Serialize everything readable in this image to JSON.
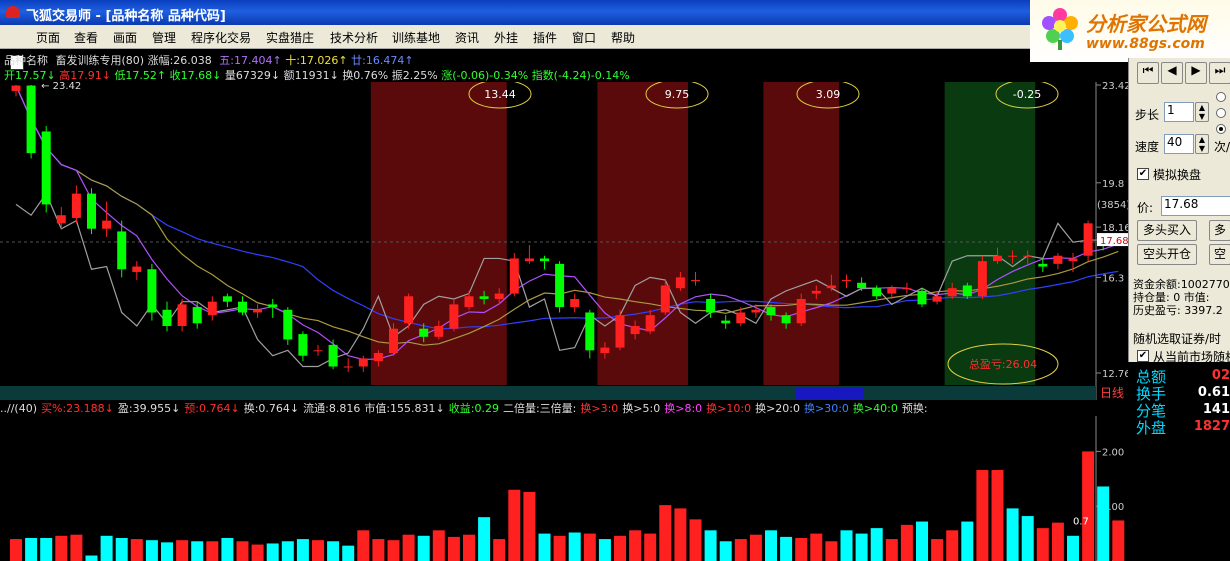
{
  "window": {
    "title": "飞狐交易师 - [品种名称 品种代码]"
  },
  "menu": [
    "页面",
    "查看",
    "画面",
    "管理",
    "程序化交易",
    "实盘猎庄",
    "技术分析",
    "训练基地",
    "资讯",
    "外挂",
    "插件",
    "窗口",
    "帮助"
  ],
  "logo": {
    "name": "分析家公式网",
    "url": "www.88gs.com"
  },
  "info_line1": {
    "name": "品种名称",
    "training": "畜发训练专用(80)",
    "amplitude": "涨幅:26.038",
    "ma5": "五:17.404↑",
    "ma10": "十:17.026↑",
    "ma20": "廿:16.474↑"
  },
  "info_line2": {
    "open": "开17.57↓",
    "high": "高17.91↓",
    "low": "低17.52↑",
    "close": "收17.68↓",
    "volume": "量67329↓",
    "amount": "额11931↓",
    "turnover": "换0.76%",
    "swing": "振2.25%",
    "change": "涨(-0.06)-0.34%",
    "index": "指数(-4.24)-0.14%"
  },
  "ellipses": [
    "13.44",
    "9.75",
    "3.09",
    "-0.25"
  ],
  "total_profit": "总盈亏:26.04",
  "high_marker": "23.42",
  "price_axis": [
    "23.42",
    "19.8",
    "18.16",
    "16.3",
    "12.76"
  ],
  "axis_badge": "(3854)",
  "current_price_tag": "17.68",
  "day_label": "日线",
  "indicator_bar": [
    {
      "t": "..//(40)",
      "c": "#ddd"
    },
    {
      "t": "买%:23.188↓",
      "c": "#ff3030"
    },
    {
      "t": "盈:39.955↓",
      "c": "#ddd"
    },
    {
      "t": "预:0.764↓",
      "c": "#ff3030"
    },
    {
      "t": "换:0.764↓",
      "c": "#ddd"
    },
    {
      "t": "流通:8.816",
      "c": "#ddd"
    },
    {
      "t": "市值:155.831↓",
      "c": "#ddd"
    },
    {
      "t": "收益:0.29",
      "c": "#30ff30"
    },
    {
      "t": "二倍量:三倍量:",
      "c": "#ddd"
    },
    {
      "t": "换>3:0",
      "c": "#ff3030"
    },
    {
      "t": "换>5:0",
      "c": "#ddd"
    },
    {
      "t": "换>8:0",
      "c": "#ff40ff"
    },
    {
      "t": "换>10:0",
      "c": "#ff3030"
    },
    {
      "t": "换>20:0",
      "c": "#ddd"
    },
    {
      "t": "换>30:0",
      "c": "#4080ff"
    },
    {
      "t": "换>40:0",
      "c": "#30ff30"
    },
    {
      "t": "预换:",
      "c": "#ddd"
    }
  ],
  "vol_axis": [
    "2.00",
    "1.00",
    "0.00"
  ],
  "vol_last_label": "0.7",
  "panel": {
    "step_label": "步长",
    "step_value": "1",
    "speed_label": "速度",
    "speed_value": "40",
    "times_label": "次/",
    "sim_label": "模拟换盘",
    "price_label": "价:",
    "price_value": "17.68",
    "btn_long_buy": "多头买入",
    "btn_long_more": "多",
    "btn_short_open": "空头开仓",
    "btn_short_more": "空",
    "fund_line": "资金余额:1002770",
    "position_line": "持仓量: 0   市值:",
    "history_line": "历史盈亏: 3397.2",
    "random_pick": "随机选取证券/时",
    "from_market": "从当前市场随机"
  },
  "data_panel": [
    {
      "label": "总额",
      "value": "02"
    },
    {
      "label": "换手",
      "value": "0.61"
    },
    {
      "label": "分笔",
      "value": "141"
    },
    {
      "label": "外盘",
      "value": "1827"
    }
  ],
  "colors": {
    "up": "#ff2020",
    "down": "#00ff00",
    "vol_up": "#ff2020",
    "vol_down": "#00ffff",
    "region_red": "#5a0a0a",
    "region_green": "#0a3a10"
  },
  "chart_data": {
    "type": "candlestick",
    "ylim": [
      12.76,
      23.42
    ],
    "candles": [
      {
        "o": 23.2,
        "c": 23.4,
        "h": 23.42,
        "l": 23.0
      },
      {
        "o": 23.4,
        "c": 20.9,
        "h": 23.42,
        "l": 20.7
      },
      {
        "o": 21.7,
        "c": 19.0,
        "h": 21.9,
        "l": 18.7
      },
      {
        "o": 18.3,
        "c": 18.6,
        "h": 18.9,
        "l": 18.1
      },
      {
        "o": 18.5,
        "c": 19.4,
        "h": 19.7,
        "l": 18.3
      },
      {
        "o": 19.4,
        "c": 18.1,
        "h": 19.6,
        "l": 17.9
      },
      {
        "o": 18.1,
        "c": 18.4,
        "h": 19.1,
        "l": 17.8
      },
      {
        "o": 18.0,
        "c": 16.6,
        "h": 18.4,
        "l": 16.3
      },
      {
        "o": 16.5,
        "c": 16.7,
        "h": 16.9,
        "l": 16.2
      },
      {
        "o": 16.6,
        "c": 15.0,
        "h": 16.8,
        "l": 14.7
      },
      {
        "o": 15.1,
        "c": 14.5,
        "h": 15.4,
        "l": 14.3
      },
      {
        "o": 14.5,
        "c": 15.3,
        "h": 15.5,
        "l": 14.3
      },
      {
        "o": 15.2,
        "c": 14.6,
        "h": 15.4,
        "l": 14.4
      },
      {
        "o": 14.9,
        "c": 15.4,
        "h": 15.6,
        "l": 14.7
      },
      {
        "o": 15.6,
        "c": 15.4,
        "h": 15.7,
        "l": 15.2
      },
      {
        "o": 15.4,
        "c": 15.0,
        "h": 15.6,
        "l": 14.9
      },
      {
        "o": 15.0,
        "c": 15.1,
        "h": 15.3,
        "l": 14.8
      },
      {
        "o": 15.3,
        "c": 15.2,
        "h": 15.5,
        "l": 14.8
      },
      {
        "o": 15.1,
        "c": 14.0,
        "h": 15.2,
        "l": 13.8
      },
      {
        "o": 14.2,
        "c": 13.4,
        "h": 14.3,
        "l": 13.2
      },
      {
        "o": 13.6,
        "c": 13.6,
        "h": 13.8,
        "l": 13.4
      },
      {
        "o": 13.8,
        "c": 13.0,
        "h": 14.0,
        "l": 12.9
      },
      {
        "o": 13.0,
        "c": 13.0,
        "h": 13.3,
        "l": 12.8
      },
      {
        "o": 13.0,
        "c": 13.3,
        "h": 13.4,
        "l": 12.8
      },
      {
        "o": 13.2,
        "c": 13.5,
        "h": 13.6,
        "l": 13.0
      },
      {
        "o": 13.5,
        "c": 14.4,
        "h": 14.6,
        "l": 13.4
      },
      {
        "o": 14.6,
        "c": 15.6,
        "h": 15.7,
        "l": 14.4
      },
      {
        "o": 14.4,
        "c": 14.1,
        "h": 14.6,
        "l": 13.9
      },
      {
        "o": 14.1,
        "c": 14.5,
        "h": 14.7,
        "l": 14.0
      },
      {
        "o": 14.4,
        "c": 15.3,
        "h": 15.5,
        "l": 14.3
      },
      {
        "o": 15.2,
        "c": 15.6,
        "h": 15.8,
        "l": 15.1
      },
      {
        "o": 15.6,
        "c": 15.5,
        "h": 15.8,
        "l": 15.3
      },
      {
        "o": 15.5,
        "c": 15.7,
        "h": 15.9,
        "l": 15.3
      },
      {
        "o": 15.7,
        "c": 17.0,
        "h": 17.2,
        "l": 15.6
      },
      {
        "o": 16.9,
        "c": 17.0,
        "h": 17.5,
        "l": 16.8
      },
      {
        "o": 17.0,
        "c": 16.9,
        "h": 17.1,
        "l": 16.6
      },
      {
        "o": 16.8,
        "c": 15.2,
        "h": 16.9,
        "l": 15.0
      },
      {
        "o": 15.2,
        "c": 15.5,
        "h": 15.7,
        "l": 15.0
      },
      {
        "o": 15.0,
        "c": 13.6,
        "h": 15.1,
        "l": 13.3
      },
      {
        "o": 13.5,
        "c": 13.7,
        "h": 13.9,
        "l": 13.3
      },
      {
        "o": 13.7,
        "c": 14.9,
        "h": 15.1,
        "l": 13.6
      },
      {
        "o": 14.2,
        "c": 14.5,
        "h": 14.7,
        "l": 14.0
      },
      {
        "o": 14.3,
        "c": 14.9,
        "h": 15.1,
        "l": 14.2
      },
      {
        "o": 15.0,
        "c": 16.0,
        "h": 16.2,
        "l": 14.9
      },
      {
        "o": 15.9,
        "c": 16.3,
        "h": 16.5,
        "l": 15.8
      },
      {
        "o": 16.2,
        "c": 16.2,
        "h": 16.5,
        "l": 16.0
      },
      {
        "o": 15.5,
        "c": 15.0,
        "h": 15.7,
        "l": 14.8
      },
      {
        "o": 14.7,
        "c": 14.6,
        "h": 14.9,
        "l": 14.4
      },
      {
        "o": 14.6,
        "c": 15.0,
        "h": 15.2,
        "l": 14.5
      },
      {
        "o": 15.0,
        "c": 15.1,
        "h": 15.3,
        "l": 14.8
      },
      {
        "o": 15.2,
        "c": 14.9,
        "h": 15.3,
        "l": 14.7
      },
      {
        "o": 14.9,
        "c": 14.6,
        "h": 15.0,
        "l": 14.4
      },
      {
        "o": 14.6,
        "c": 15.5,
        "h": 15.7,
        "l": 14.5
      },
      {
        "o": 15.7,
        "c": 15.8,
        "h": 16.0,
        "l": 15.5
      },
      {
        "o": 15.9,
        "c": 16.0,
        "h": 16.4,
        "l": 15.8
      },
      {
        "o": 16.2,
        "c": 16.2,
        "h": 16.4,
        "l": 15.9
      },
      {
        "o": 16.1,
        "c": 15.9,
        "h": 16.3,
        "l": 15.8
      },
      {
        "o": 15.9,
        "c": 15.6,
        "h": 16.0,
        "l": 15.5
      },
      {
        "o": 15.7,
        "c": 15.9,
        "h": 16.0,
        "l": 15.5
      },
      {
        "o": 15.9,
        "c": 15.9,
        "h": 16.1,
        "l": 15.7
      },
      {
        "o": 15.8,
        "c": 15.3,
        "h": 15.9,
        "l": 15.2
      },
      {
        "o": 15.4,
        "c": 15.6,
        "h": 15.8,
        "l": 15.3
      },
      {
        "o": 15.6,
        "c": 15.9,
        "h": 16.1,
        "l": 15.5
      },
      {
        "o": 16.0,
        "c": 15.6,
        "h": 16.1,
        "l": 15.5
      },
      {
        "o": 15.6,
        "c": 16.9,
        "h": 17.1,
        "l": 15.5
      },
      {
        "o": 16.9,
        "c": 17.1,
        "h": 17.4,
        "l": 16.8
      },
      {
        "o": 17.1,
        "c": 17.1,
        "h": 17.3,
        "l": 16.8
      },
      {
        "o": 17.1,
        "c": 17.1,
        "h": 17.3,
        "l": 16.8
      },
      {
        "o": 16.8,
        "c": 16.7,
        "h": 17.0,
        "l": 16.5
      },
      {
        "o": 16.8,
        "c": 17.1,
        "h": 17.2,
        "l": 16.6
      },
      {
        "o": 16.9,
        "c": 17.0,
        "h": 17.2,
        "l": 16.5
      },
      {
        "o": 17.1,
        "c": 18.3,
        "h": 18.4,
        "l": 16.9
      },
      {
        "o": 17.7,
        "c": 17.6,
        "h": 17.9,
        "l": 17.3
      },
      {
        "o": 17.57,
        "c": 17.68,
        "h": 17.91,
        "l": 17.52
      }
    ],
    "regions": [
      {
        "type": "red",
        "from": 24,
        "to": 32
      },
      {
        "type": "red",
        "from": 39,
        "to": 44
      },
      {
        "type": "red",
        "from": 50,
        "to": 54
      },
      {
        "type": "green",
        "from": 62,
        "to": 67
      }
    ],
    "volume_ylim": [
      0,
      2.5
    ],
    "volumes": [
      0.4,
      0.42,
      0.42,
      0.46,
      0.48,
      0.1,
      0.46,
      0.42,
      0.4,
      0.38,
      0.34,
      0.38,
      0.36,
      0.36,
      0.42,
      0.36,
      0.3,
      0.32,
      0.36,
      0.4,
      0.38,
      0.36,
      0.28,
      0.56,
      0.4,
      0.38,
      0.48,
      0.46,
      0.56,
      0.44,
      0.48,
      0.8,
      0.4,
      1.3,
      1.26,
      0.5,
      0.46,
      0.52,
      0.5,
      0.4,
      0.46,
      0.56,
      0.5,
      1.02,
      0.96,
      0.76,
      0.56,
      0.36,
      0.4,
      0.48,
      0.56,
      0.44,
      0.42,
      0.5,
      0.36,
      0.56,
      0.5,
      0.6,
      0.4,
      0.66,
      0.72,
      0.4,
      0.56,
      0.72,
      1.66,
      1.66,
      0.96,
      0.82,
      0.6,
      0.7,
      0.46,
      2.0,
      1.36,
      0.74
    ],
    "volume_up": [
      true,
      false,
      false,
      true,
      true,
      false,
      false,
      false,
      true,
      false,
      false,
      true,
      false,
      true,
      false,
      true,
      true,
      false,
      false,
      false,
      true,
      false,
      false,
      true,
      true,
      true,
      true,
      false,
      true,
      true,
      true,
      false,
      true,
      true,
      true,
      false,
      true,
      false,
      true,
      false,
      true,
      true,
      true,
      true,
      true,
      true,
      false,
      false,
      true,
      true,
      false,
      false,
      true,
      true,
      true,
      false,
      false,
      false,
      true,
      true,
      false,
      true,
      true,
      false,
      true,
      true,
      false,
      false,
      true,
      true,
      false,
      true,
      false,
      true
    ]
  }
}
